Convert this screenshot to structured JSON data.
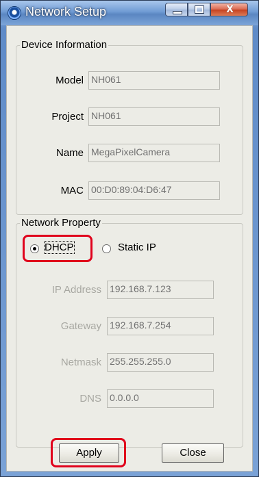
{
  "window": {
    "title": "Network Setup",
    "close_glyph": "X",
    "accent_colors": {
      "highlight": "#e0001b",
      "titlebar": "#5a86c1"
    }
  },
  "device_info": {
    "legend": "Device Information",
    "fields": [
      {
        "label": "Model",
        "value": "NH061"
      },
      {
        "label": "Project",
        "value": "NH061"
      },
      {
        "label": "Name",
        "value": "MegaPixelCamera"
      },
      {
        "label": "MAC",
        "value": "00:D0:89:04:D6:47"
      }
    ]
  },
  "network": {
    "legend": "Network Property",
    "mode_options": [
      {
        "label": "DHCP",
        "selected": true
      },
      {
        "label": "Static IP",
        "selected": false
      }
    ],
    "fields": [
      {
        "label": "IP Address",
        "value": "192.168.7.123"
      },
      {
        "label": "Gateway",
        "value": "192.168.7.254"
      },
      {
        "label": "Netmask",
        "value": "255.255.255.0"
      },
      {
        "label": "DNS",
        "value": "0.0.0.0"
      }
    ]
  },
  "actions": {
    "apply_label": "Apply",
    "close_label": "Close"
  },
  "icons": {
    "app": "network-globe-icon",
    "minimize": "minimize-icon",
    "maximize": "maximize-icon",
    "close": "close-icon"
  }
}
